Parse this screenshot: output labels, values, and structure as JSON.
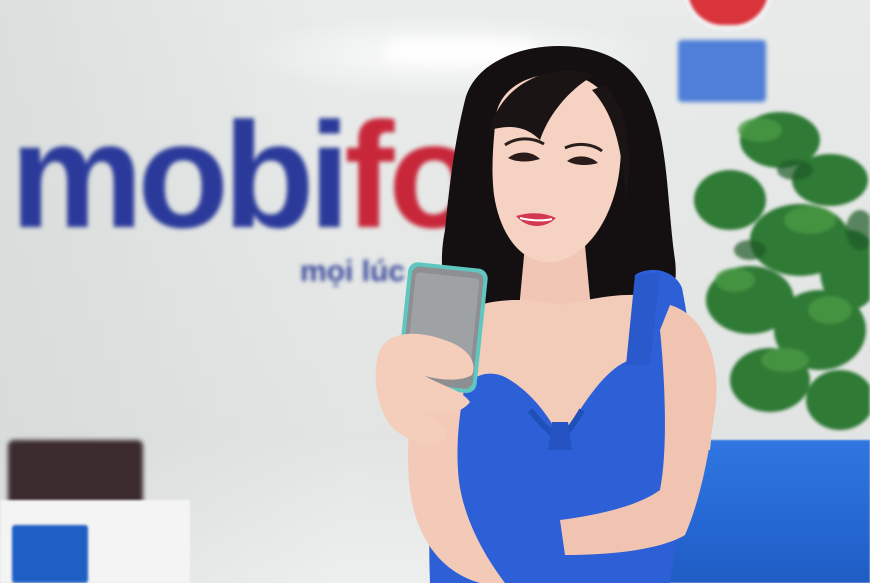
{
  "scene": {
    "logo": {
      "word_part_blue": "mobi",
      "word_part_red": "fon",
      "tagline": "mọi lúc"
    },
    "colors": {
      "brand_blue": "#2b3a9a",
      "brand_red": "#c8273a",
      "dress_blue": "#2d5fd6",
      "phone_gray": "#8d8f92",
      "phone_trim": "#5fc7c0",
      "plant_green": "#2f7a35",
      "chair_blue": "#2a6fdc"
    }
  }
}
